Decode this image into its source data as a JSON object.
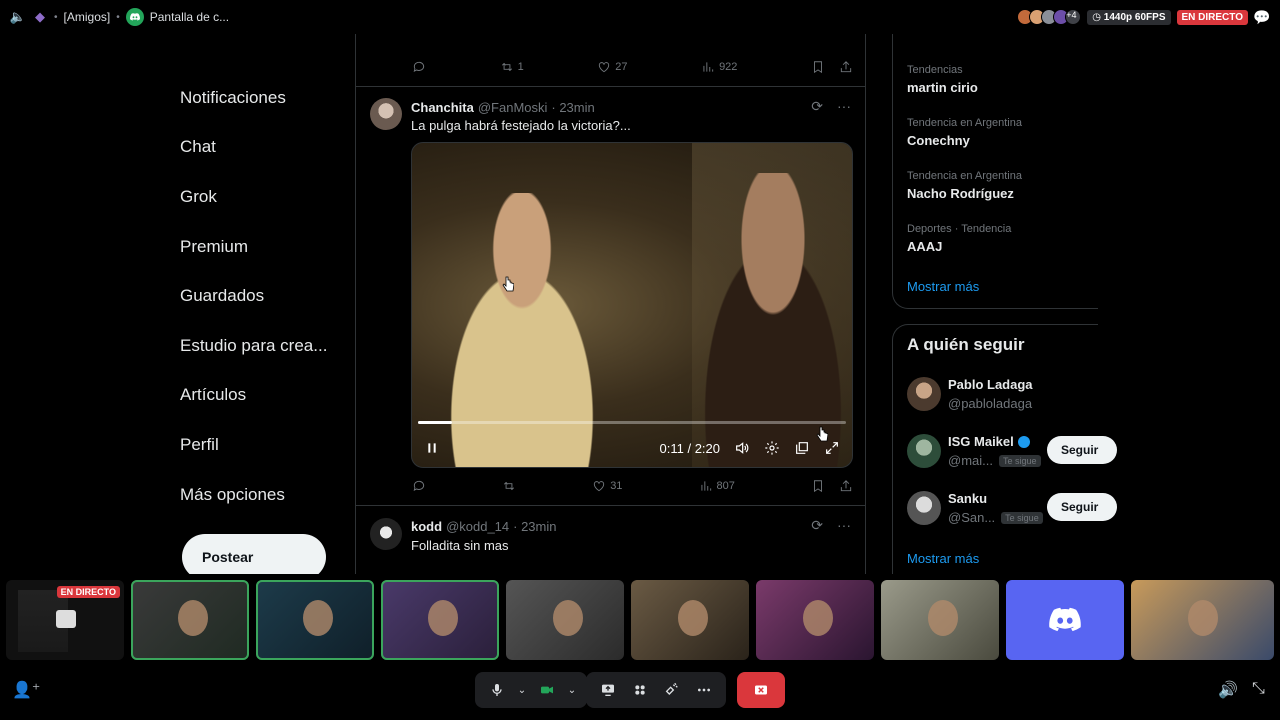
{
  "topbar": {
    "channel": "[Amigos]",
    "stream_title": "Pantalla de c...",
    "extra_viewers": "+4",
    "quality": "1440p 60FPS",
    "live_label": "EN DIRECTO"
  },
  "x_nav": {
    "items": [
      "Notificaciones",
      "Chat",
      "Grok",
      "Premium",
      "Guardados",
      "Estudio para crea...",
      "Artículos",
      "Perfil",
      "Más opciones"
    ],
    "post_label": "Postear"
  },
  "feed": {
    "prev_tweet_actions": {
      "replies": "",
      "reposts": "1",
      "likes": "27",
      "views": "922"
    },
    "tweet1": {
      "name": "Chanchita",
      "handle": "@FanMoski",
      "time": "· 23min",
      "text": "La pulga habrá festejado la victoria?...",
      "video": {
        "time": "0:11 / 2:20",
        "progress": 0.08
      },
      "actions": {
        "replies": "",
        "reposts": "",
        "likes": "31",
        "views": "807"
      }
    },
    "tweet2": {
      "name": "kodd",
      "handle": "@kodd_14",
      "time": "· 23min",
      "text": "Folladita sin mas"
    }
  },
  "trends": [
    {
      "category": "Tendencias",
      "name": "martin cirio"
    },
    {
      "category": "Tendencia en Argentina",
      "name": "Conechny"
    },
    {
      "category": "Tendencia en Argentina",
      "name": "Nacho Rodríguez"
    },
    {
      "category": "Deportes · Tendencia",
      "name": "AAAJ"
    }
  ],
  "trends_more": "Mostrar más",
  "who_to_follow": {
    "title": "A quién seguir",
    "users": [
      {
        "name": "Pablo Ladaga",
        "handle": "@pabloladaga",
        "follows_you": "",
        "button": ""
      },
      {
        "name": "ISG Maikel",
        "handle": "@mai...",
        "follows_you": "Te sigue",
        "button": "Seguir"
      },
      {
        "name": "Sanku",
        "handle": "@San...",
        "follows_you": "Te sigue",
        "button": "Seguir"
      }
    ],
    "more": "Mostrar más"
  },
  "strip": {
    "live_label": "EN DIRECTO"
  },
  "colors": {
    "accent_live": "#da373c",
    "discord_blurple": "#5865f2",
    "x_blue": "#1d9bf0",
    "speaking": "#3ba55c"
  }
}
